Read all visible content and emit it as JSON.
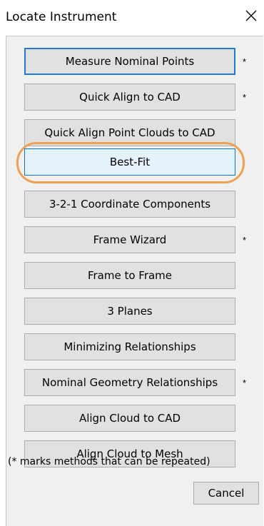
{
  "window": {
    "title": "Locate Instrument"
  },
  "buttons": [
    {
      "label": "Measure Nominal Points",
      "repeatable": true
    },
    {
      "label": "Quick Align to CAD",
      "repeatable": true
    },
    {
      "label": "Quick Align Point Clouds to CAD",
      "repeatable": false
    },
    {
      "label": "Best-Fit",
      "repeatable": false
    },
    {
      "label": "3-2-1 Coordinate Components",
      "repeatable": false
    },
    {
      "label": "Frame Wizard",
      "repeatable": true
    },
    {
      "label": "Frame to Frame",
      "repeatable": false
    },
    {
      "label": "3 Planes",
      "repeatable": false
    },
    {
      "label": "Minimizing Relationships",
      "repeatable": false
    },
    {
      "label": "Nominal Geometry Relationships",
      "repeatable": true
    },
    {
      "label": "Align Cloud to CAD",
      "repeatable": false
    },
    {
      "label": "Align Cloud to Mesh",
      "repeatable": false
    }
  ],
  "repeat_marker": "*",
  "footnote": "(* marks methods that can be repeated)",
  "cancel_label": "Cancel",
  "colors": {
    "highlight": "#f0a053",
    "default_border": "#1f7ad1",
    "selected_bg": "#e5f1fb"
  }
}
